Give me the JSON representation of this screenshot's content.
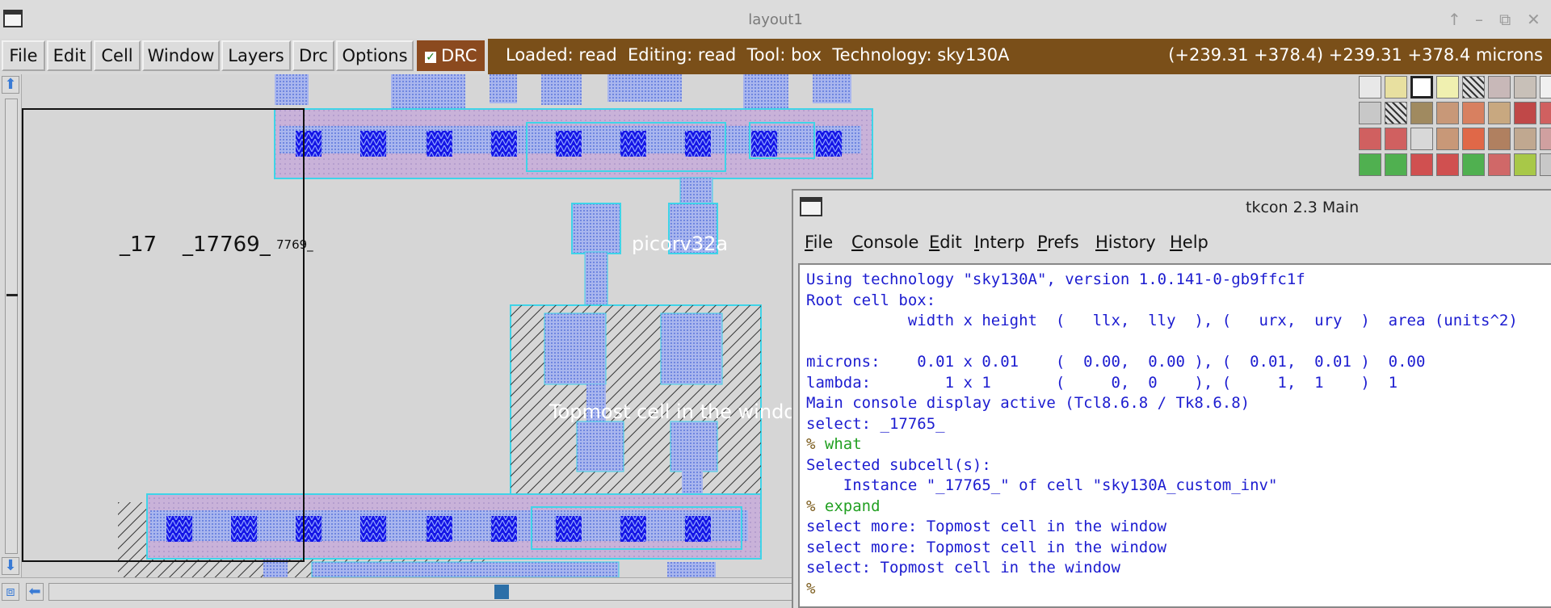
{
  "window": {
    "title": "layout1",
    "controls": [
      "↑",
      "–",
      "⧉",
      "✕"
    ]
  },
  "menubar": {
    "items": [
      "File",
      "Edit",
      "Cell",
      "Window",
      "Layers",
      "Drc",
      "Options"
    ],
    "drc_toggle": "DRC"
  },
  "status": {
    "text": "Loaded: read  Editing: read  Tool: box  Technology: sky130A",
    "coords": "(+239.31 +378.4) +239.31 +378.4 microns"
  },
  "canvas": {
    "labels": {
      "l1": "_17",
      "l2": "_17769_",
      "l3": "7769_",
      "cell": "picorv32a",
      "topmost": "Topmost cell in the windo"
    }
  },
  "tkcon": {
    "title": "tkcon 2.3 Main",
    "menu": [
      {
        "key": "F",
        "rest": "ile"
      },
      {
        "key": "C",
        "rest": "onsole"
      },
      {
        "key": "E",
        "rest": "dit"
      },
      {
        "key": "I",
        "rest": "nterp"
      },
      {
        "key": "P",
        "rest": "refs"
      },
      {
        "key": "H",
        "rest": "istory"
      },
      {
        "key": "H",
        "rest": "elp"
      }
    ],
    "lines": [
      {
        "t": "Using technology \"sky130A\", version 1.0.141-0-gb9ffc1f",
        "k": "out"
      },
      {
        "t": "Root cell box:",
        "k": "out"
      },
      {
        "t": "           width x height  (   llx,  lly  ), (   urx,  ury  )  area (units^2)",
        "k": "out"
      },
      {
        "t": "",
        "k": "out"
      },
      {
        "t": "microns:    0.01 x 0.01    (  0.00,  0.00 ), (  0.01,  0.01 )  0.00",
        "k": "out"
      },
      {
        "t": "lambda:        1 x 1       (     0,  0    ), (     1,  1    )  1",
        "k": "out"
      },
      {
        "t": "Main console display active (Tcl8.6.8 / Tk8.6.8)",
        "k": "out"
      },
      {
        "t": "select: _17765_",
        "k": "out"
      },
      {
        "t": "% what",
        "k": "cmd"
      },
      {
        "t": "Selected subcell(s):",
        "k": "out"
      },
      {
        "t": "    Instance \"_17765_\" of cell \"sky130A_custom_inv\"",
        "k": "out"
      },
      {
        "t": "% expand",
        "k": "cmd"
      },
      {
        "t": "select more: Topmost cell in the window",
        "k": "out"
      },
      {
        "t": "select more: Topmost cell in the window",
        "k": "out"
      },
      {
        "t": "select: Topmost cell in the window",
        "k": "out"
      },
      {
        "t": "%",
        "k": "prompt"
      }
    ]
  },
  "colors": {
    "status_bg": "#7a4f19",
    "drc_bg": "#8b4a1f",
    "console_text": "#1c1cd0",
    "console_cmd": "#22a022",
    "metal": "#a8b8f0",
    "contact": "#1010e0",
    "poly_box": "#c8b0d8",
    "outline": "#3fd4e8"
  }
}
